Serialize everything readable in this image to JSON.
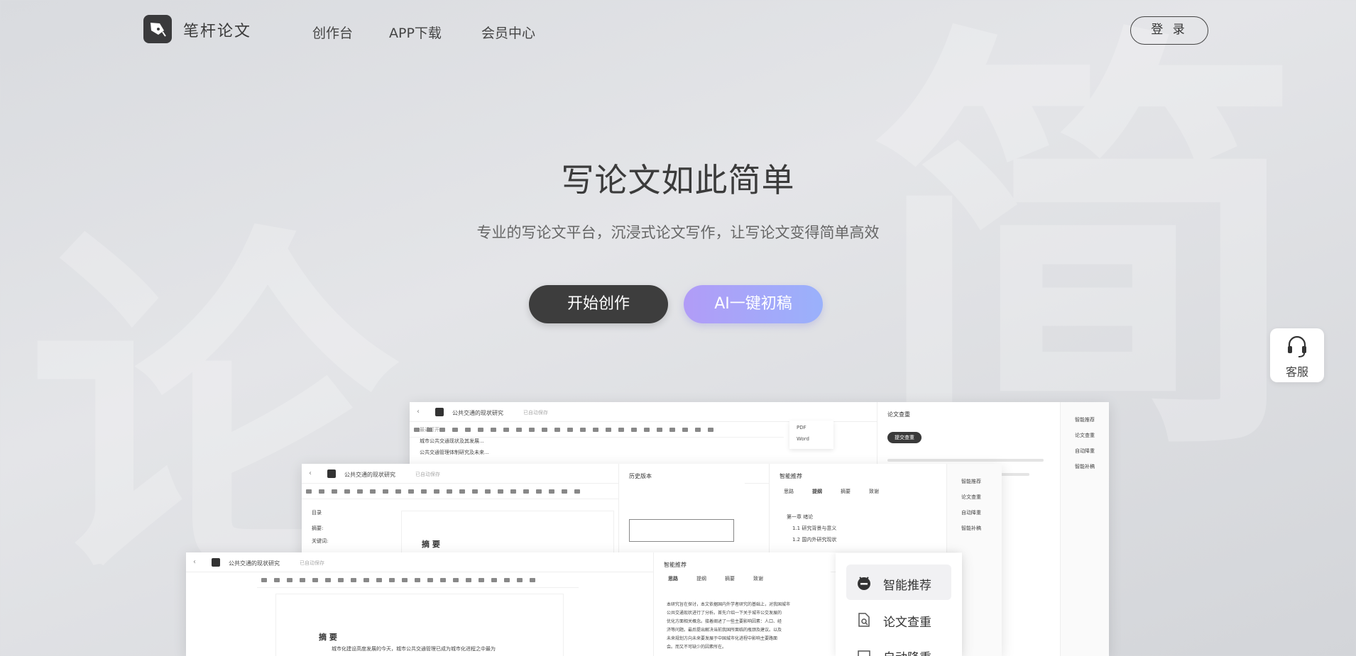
{
  "header": {
    "brand": "笔杆论文",
    "nav": [
      "创作台",
      "APP下载",
      "会员中心"
    ],
    "login": "登 录"
  },
  "hero": {
    "title": "写论文如此简单",
    "subtitle": "专业的写论文平台，沉浸式论文写作，让写论文变得简单高效",
    "btn_start": "开始创作",
    "btn_ai": "AI一键初稿"
  },
  "service": {
    "label": "客服"
  },
  "preview": {
    "doc_title": "公共交通的现状研究",
    "autosave": "已自动保存",
    "w1_panel_title": "论文查重",
    "w1_panel_btn": "提交查重",
    "w1_side": [
      "智能推荐",
      "论文查重",
      "自动降重",
      "智能补稿"
    ],
    "w1_menu": [
      "最近打开",
      "城市公共交通现状及其发展...",
      "公共交通管理体制研究及未来..."
    ],
    "export_menu": [
      "PDF",
      "Word"
    ],
    "w2_panel_title": "智能推荐",
    "w2_tabs": [
      "思路",
      "提纲",
      "摘要",
      "致谢"
    ],
    "w2_outline": [
      "第一章 绪论",
      "1.1 研究背景与意义",
      "1.2 国内外研究现状"
    ],
    "w2_history": "历史版本",
    "w2_side": [
      "智能推荐",
      "论文查重",
      "自动降重",
      "智能补稿"
    ],
    "w2_toc": [
      "目录",
      "摘要:",
      "关键词:"
    ],
    "w2_doc_heading": "摘 要",
    "w3_panel_title": "智能推荐",
    "w3_tabs": [
      "思路",
      "提纲",
      "摘要",
      "致谢"
    ],
    "w3_doc_heading": "摘 要",
    "w3_doc_text": "城市化建设高度发展的今天，城市公共交通管理已成为城市化进程之中最为",
    "w3_panel_text": [
      "本研究旨在探讨，本文依据国内外学者研究的基础上，对我国城市",
      "公共交通现状进行了分析。首先介绍一下关于城市公交发展的",
      "优化方面相关概念。接着阐述了一些主要影响因素：人口、经",
      "济等问题。最后提出解决当前我国所面临的瓶颈及建议。以及",
      "未来规划方向未来要发展于中国城市化进程中影响主要路面",
      "会。而又不可缺少的因素所在。"
    ],
    "features": [
      "智能推荐",
      "论文查重",
      "自动降重"
    ]
  }
}
